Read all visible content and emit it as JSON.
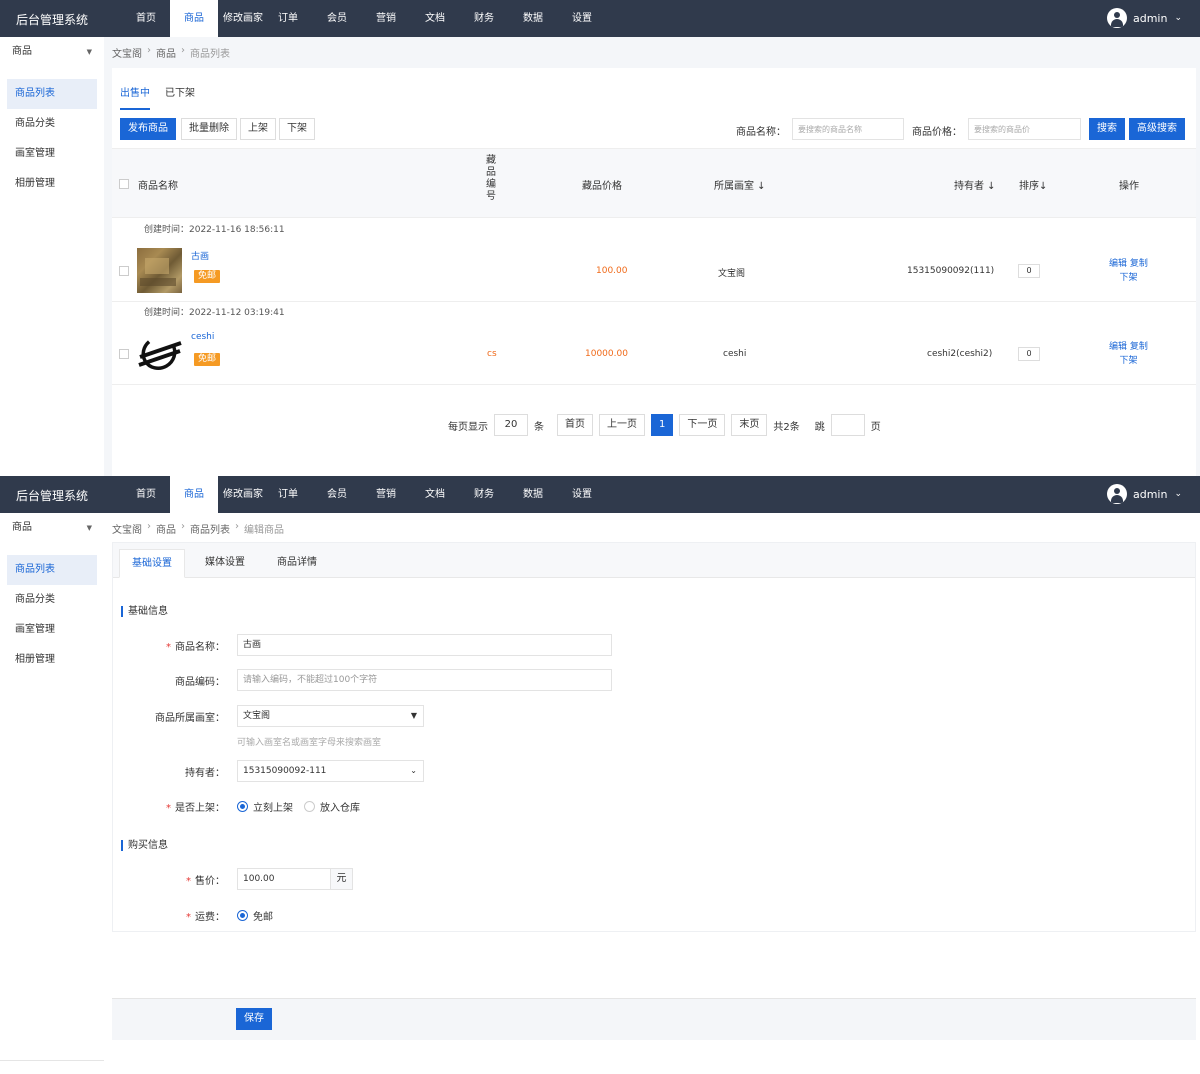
{
  "app": {
    "brand": "后台管理系统",
    "nav": [
      {
        "label": "首页",
        "active": false
      },
      {
        "label": "商品",
        "active": true
      },
      {
        "label": "修改画家",
        "active": false
      },
      {
        "label": "订单",
        "active": false
      },
      {
        "label": "会员",
        "active": false
      },
      {
        "label": "营销",
        "active": false
      },
      {
        "label": "文档",
        "active": false
      },
      {
        "label": "财务",
        "active": false
      },
      {
        "label": "数据",
        "active": false
      },
      {
        "label": "设置",
        "active": false
      }
    ],
    "user": "admin",
    "chevron": "⌄",
    "accent": "#1a66d6",
    "header_bg": "#303a4c"
  },
  "sidebar": {
    "head": "商品",
    "caret": "▼",
    "items": [
      "商品列表",
      "商品分类",
      "画室管理",
      "相册管理"
    ]
  },
  "list_page": {
    "breadcrumb": [
      "文宝阁",
      "商品",
      "商品列表"
    ],
    "tabs": [
      "出售中",
      "已下架"
    ],
    "buttons": {
      "publish": "发布商品",
      "batch_delete": "批量删除",
      "on_shelf": "上架",
      "off_shelf": "下架",
      "search": "搜索",
      "advanced": "高级搜索"
    },
    "filters": {
      "name_label": "商品名称：",
      "name_placeholder": "要搜索的商品名称",
      "price_label": "商品价格：",
      "price_placeholder": "要搜索的商品价"
    },
    "columns": {
      "name": "商品名称",
      "code": [
        "藏",
        "品",
        "编",
        "号"
      ],
      "price": "藏品价格",
      "studio": "所属画室 ↓",
      "owner": "持有者 ↓",
      "sort": "排序↓",
      "ops": "操作"
    },
    "rows": [
      {
        "date": "创建时间：2022-11-16 18:56:11",
        "name": "古画",
        "badge": "免邮",
        "code": "",
        "price": "100.00",
        "studio": "文宝阁",
        "owner": "15315090092(111)",
        "sort": "0",
        "edit": "编辑",
        "copy": "复制",
        "off": "下架",
        "thumb": "painting-image"
      },
      {
        "date": "创建时间：2022-11-12 03:19:41",
        "name": "ceshi",
        "badge": "免邮",
        "code": "cs",
        "price": "10000.00",
        "studio": "ceshi",
        "owner": "ceshi2(ceshi2)",
        "sort": "0",
        "edit": "编辑",
        "copy": "复制",
        "off": "下架",
        "thumb": "stellar-logo-icon"
      }
    ],
    "pager": {
      "per_page_label": "每页显示",
      "per_page": "20",
      "unit": "条",
      "first": "首页",
      "prev": "上一页",
      "current": "1",
      "next": "下一页",
      "last": "末页",
      "total": "共2条",
      "jump": "跳",
      "page": "页"
    }
  },
  "edit_page": {
    "breadcrumb": [
      "文宝阁",
      "商品",
      "商品列表",
      "编辑商品"
    ],
    "tabs": [
      "基础设置",
      "媒体设置",
      "商品详情"
    ],
    "section_basic": "基础信息",
    "section_buy": "购买信息",
    "fields": {
      "name_label": "商品名称：",
      "name_value": "古画",
      "code_label": "商品编码：",
      "code_placeholder": "请输入编码，不能超过100个字符",
      "studio_label": "商品所属画室：",
      "studio_value": "文宝阁",
      "studio_hint": "可输入画室名或画室字母来搜索画室",
      "owner_label": "持有者：",
      "owner_value": "15315090092-111",
      "shelf_label": "是否上架：",
      "shelf_options": [
        "立刻上架",
        "放入仓库"
      ],
      "price_label": "售价：",
      "price_value": "100.00",
      "price_unit": "元",
      "freight_label": "运费：",
      "freight_option": "免邮"
    },
    "required_mark": "*",
    "caret_solid": "▼",
    "caret_outline": "⌄",
    "save": "保存"
  }
}
